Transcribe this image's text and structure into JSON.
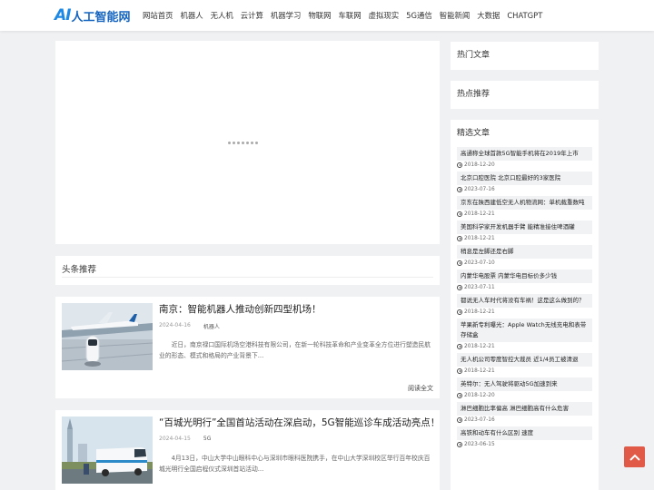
{
  "brand": {
    "logo_ai": "AI",
    "logo_text": "人工智能网"
  },
  "nav": [
    "网站首页",
    "机器人",
    "无人机",
    "云计算",
    "机器学习",
    "物联网",
    "车联网",
    "虚拟现实",
    "5G通信",
    "智能新闻",
    "大数据",
    "CHATGPT"
  ],
  "section": {
    "title": "头条推荐"
  },
  "articles": [
    {
      "title": "南京：智能机器人推动创新四型机场！",
      "date": "2024-04-16",
      "category": "机器人",
      "excerpt": "近日，南京禄口国际机场空港科技有限公司，在新一轮科技革命和产业变革全方位进行塑造民航业的形态、模式和格局的产业背景下...",
      "read_more": "阅读全文"
    },
    {
      "title": "“百城光明行”全国首站活动在深启动，5G智能巡诊车成活动亮点！",
      "date": "2024-04-15",
      "category": "5G",
      "excerpt": "4月13日，中山大学中山眼科中心与深圳市眼科医院携手，在中山大学深圳校区举行百年校庆百城光明行全国启程仪式深圳首站活动..."
    }
  ],
  "sidebar": {
    "hot_title": "热门文章",
    "point_title": "热点推荐",
    "pick_title": "精选文章",
    "picks": [
      {
        "title": "高通称全球首款5G智能手机将在2019年上市",
        "date": "2018-12-20"
      },
      {
        "title": "北京口腔医院 北京口腔最好的3家医院",
        "date": "2023-07-16"
      },
      {
        "title": "京东在陕西建低空无人机物流网：单机载重数吨",
        "date": "2018-12-21"
      },
      {
        "title": "美国科学家开发机器手臂 能精准接住啤酒罐",
        "date": "2018-12-21"
      },
      {
        "title": "稍息是左脚还是右脚",
        "date": "2023-07-10"
      },
      {
        "title": "内蒙华电股票 内蒙华电目标价多少钱",
        "date": "2023-07-11"
      },
      {
        "title": "都说无人车时代将没有车祸！这是这么做到的？",
        "date": "2018-12-21"
      },
      {
        "title": "苹果新专利曝光：Apple Watch无线充电和表带存储盒",
        "date": "2018-12-21"
      },
      {
        "title": "无人机公司零度智控大裁员 近1/4员工被清退",
        "date": "2018-12-21"
      },
      {
        "title": "英特尔：无人驾驶将驱动5G加速到来",
        "date": "2018-12-20"
      },
      {
        "title": "淋巴细胞比率偏高 淋巴细胞高有什么危害",
        "date": "2023-07-16"
      },
      {
        "title": "高铁和动车有什么区别 速度",
        "date": "2023-06-15"
      }
    ]
  },
  "colors": {
    "accent": "#e05a47",
    "brand": "#1e88e5"
  }
}
